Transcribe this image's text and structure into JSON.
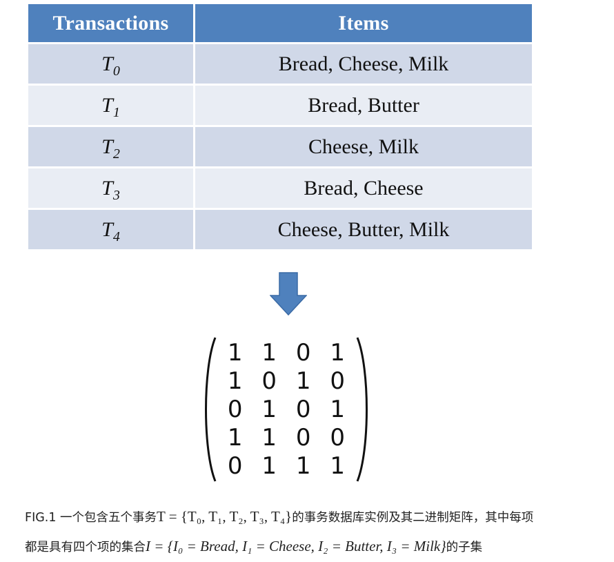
{
  "table": {
    "headers": [
      "Transactions",
      "Items"
    ],
    "rows": [
      {
        "tid": "T",
        "sub": "0",
        "items": "Bread, Cheese, Milk"
      },
      {
        "tid": "T",
        "sub": "1",
        "items": "Bread, Butter"
      },
      {
        "tid": "T",
        "sub": "2",
        "items": "Cheese, Milk"
      },
      {
        "tid": "T",
        "sub": "3",
        "items": "Bread, Cheese"
      },
      {
        "tid": "T",
        "sub": "4",
        "items": "Cheese, Butter, Milk"
      }
    ]
  },
  "arrow": {
    "icon": "arrow-down-icon",
    "color": "#4f81bd"
  },
  "matrix": [
    [
      "1",
      "1",
      "0",
      "1"
    ],
    [
      "1",
      "0",
      "1",
      "0"
    ],
    [
      "0",
      "1",
      "0",
      "1"
    ],
    [
      "1",
      "1",
      "0",
      "0"
    ],
    [
      "0",
      "1",
      "1",
      "1"
    ]
  ],
  "caption": {
    "line1_prefix": "FIG.1 一个包含五个事务",
    "line1_math": "T = {T₀, T₁, T₂, T₃, T₄}",
    "line1_suffix": "的事务数据库实例及其二进制矩阵，其中每项",
    "line2_prefix": "都是具有四个项的集合",
    "line2_math": "I = {I₀ = Bread, I₁ = Cheese, I₂ = Butter, I₃ = Milk}",
    "line2_suffix": "的子集"
  },
  "colors": {
    "header_bg": "#4f81bd",
    "row_odd": "#d0d8e8",
    "row_even": "#e9edf4"
  }
}
